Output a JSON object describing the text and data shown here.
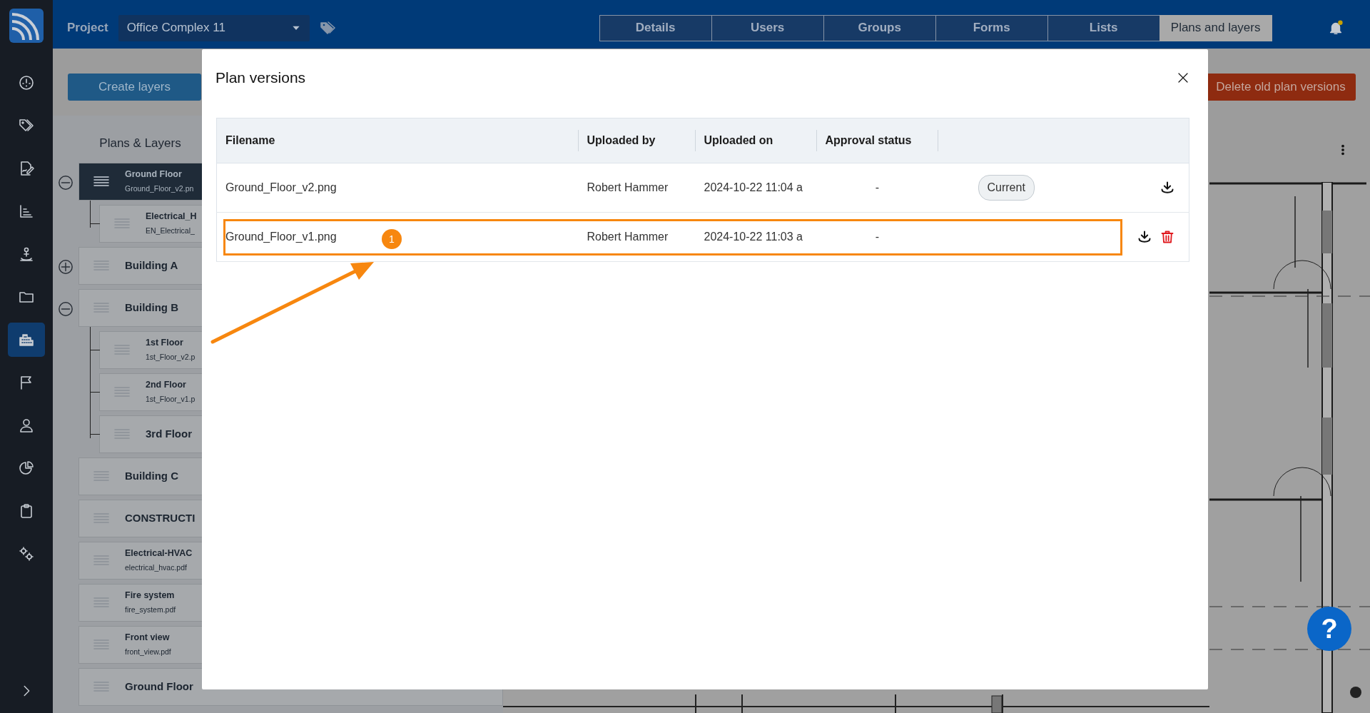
{
  "sidebar": {
    "items": [
      {
        "selected": false
      },
      {
        "selected": false
      },
      {
        "selected": false
      },
      {
        "selected": false
      },
      {
        "selected": false
      },
      {
        "selected": false
      },
      {
        "selected": true
      },
      {
        "selected": false
      },
      {
        "selected": false
      },
      {
        "selected": false
      },
      {
        "selected": false
      },
      {
        "selected": false
      }
    ]
  },
  "top_bar": {
    "project_label": "Project",
    "project": "Office Complex 11",
    "tabs": [
      {
        "label": "Details",
        "selected": false
      },
      {
        "label": "Users",
        "selected": false
      },
      {
        "label": "Groups",
        "selected": false
      },
      {
        "label": "Forms",
        "selected": false
      },
      {
        "label": "Lists",
        "selected": false
      },
      {
        "label": "Plans and layers",
        "selected": true
      }
    ]
  },
  "toolbar": {
    "create_button": "Create layers",
    "delete_button": "Delete old plan versions"
  },
  "plans_panel": {
    "title": "Plans & Layers",
    "items": [
      {
        "title": "Ground Floor",
        "file": "Ground_Floor_v2.pn",
        "selected": true,
        "expanded": true,
        "children": [
          {
            "title": "Electrical_H",
            "file": "EN_Electrical_",
            "selected": false
          }
        ]
      },
      {
        "title": "Building A",
        "selected": false,
        "expanded": false
      },
      {
        "title": "Building B",
        "selected": false,
        "expanded": true,
        "children": [
          {
            "title": "1st Floor",
            "file": "1st_Floor_v2.p",
            "selected": false
          },
          {
            "title": "2nd Floor",
            "file": "1st_Floor_v1.p",
            "selected": false
          },
          {
            "title": "3rd Floor",
            "selected": false
          }
        ]
      },
      {
        "title": "Building C",
        "selected": false
      },
      {
        "title": "CONSTRUCTI",
        "selected": false
      },
      {
        "title": "Electrical-HVAC",
        "file": "electrical_hvac.pdf",
        "selected": false
      },
      {
        "title": "Fire system",
        "file": "fire_system.pdf",
        "selected": false
      },
      {
        "title": "Front view",
        "file": "front_view.pdf",
        "selected": false
      },
      {
        "title": "Ground Floor",
        "selected": false
      }
    ]
  },
  "modal": {
    "title": "Plan versions",
    "columns": [
      "Filename",
      "Uploaded by",
      "Uploaded on",
      "Approval status"
    ],
    "rows": [
      {
        "filename": "Ground_Floor_v2.png",
        "uploaded_by": "Robert Hammer",
        "uploaded_on": "2024-10-22 11:04 a",
        "approval": "-",
        "badge": "Current",
        "highlighted": false,
        "actions": [
          {
            "kind": "download"
          }
        ]
      },
      {
        "filename": "Ground_Floor_v1.png",
        "uploaded_by": "Robert Hammer",
        "uploaded_on": "2024-10-22 11:03 a",
        "approval": "-",
        "highlighted": true,
        "actions": [
          {
            "kind": "download"
          },
          {
            "kind": "delete"
          }
        ]
      }
    ],
    "step_marker": "1"
  },
  "help_button": "?"
}
